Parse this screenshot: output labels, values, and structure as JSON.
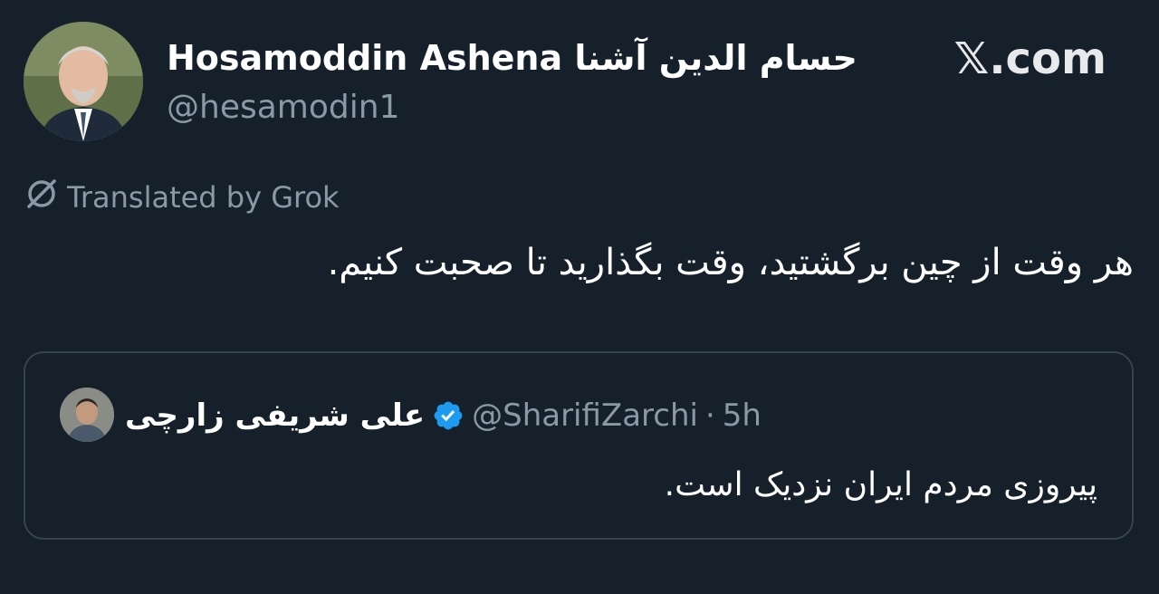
{
  "author": {
    "display_name": "Hosamoddin Ashena حسام الدین آشنا",
    "handle": "@hesamodin1"
  },
  "brand": {
    "label": "𝕏.com"
  },
  "translation": {
    "icon": "grok-icon",
    "label": "Translated by Grok"
  },
  "tweet": {
    "text": "هر وقت از چین برگشتید، وقت بگذارید تا صحبت کنیم."
  },
  "quote": {
    "display_name": "علی شریفی زارچی",
    "verified": true,
    "handle": "@SharifiZarchi",
    "separator": "·",
    "time": "5h",
    "text": "پیروزی مردم ایران نزدیک است.",
    "verified_color": "#1d9bf0"
  },
  "colors": {
    "background": "#15202b",
    "border": "#38444d",
    "muted_text": "#8b98a5",
    "primary_text": "#ffffff"
  }
}
